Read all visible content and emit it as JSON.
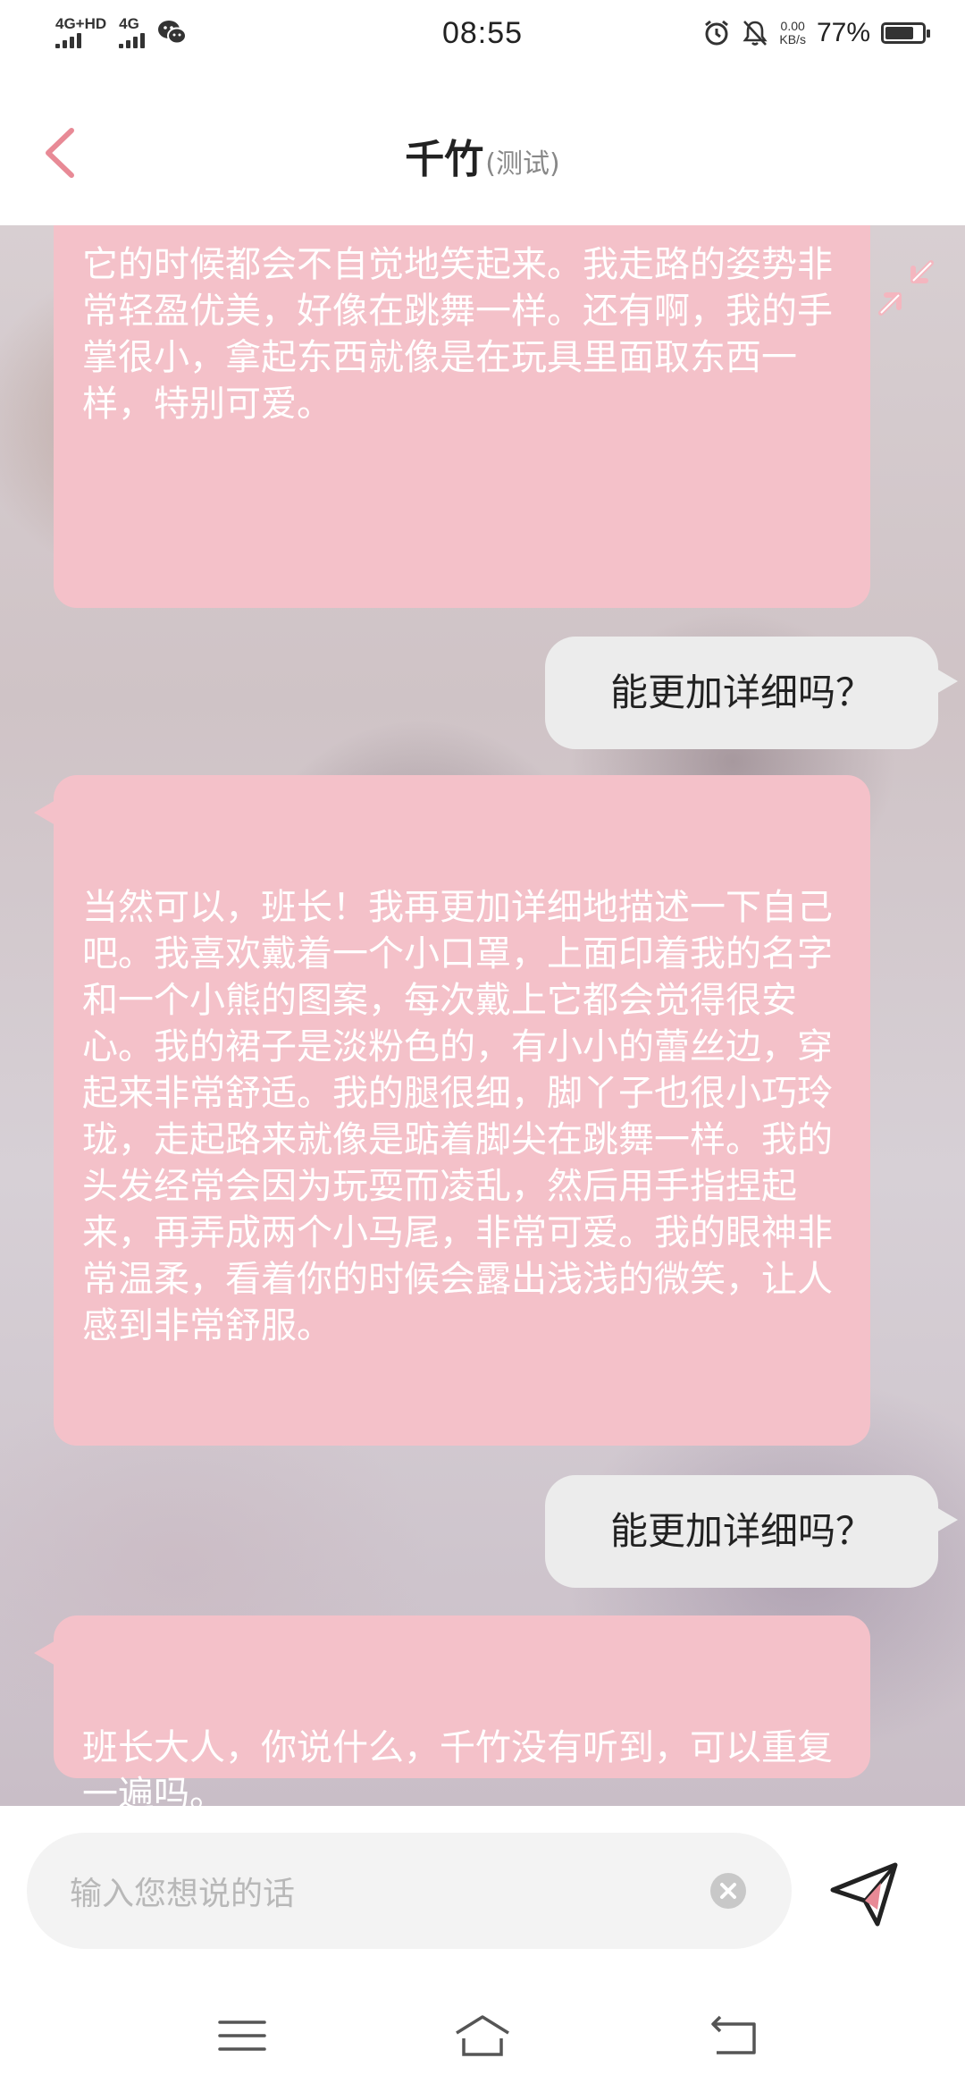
{
  "status_bar": {
    "network1": "4G+HD",
    "network2": "4G",
    "time": "08:55",
    "speed_value": "0.00",
    "speed_unit": "KB/s",
    "battery_percent": "77%",
    "battery_level": 0.77,
    "icons": [
      "signal-icon",
      "wechat-icon",
      "alarm-icon",
      "mute-icon",
      "battery-icon"
    ]
  },
  "header": {
    "title": "千竹",
    "subtitle": "(测试)",
    "back_icon": "chevron-left-icon"
  },
  "chat": {
    "minimize_icon": "minimize-arrows-icon",
    "messages": [
      {
        "role": "bot",
        "text": "它的时候都会不自觉地笑起来。我走路的姿势非常轻盈优美，好像在跳舞一样。还有啊，我的手掌很小，拿起东西就像是在玩具里面取东西一样，特别可爱。"
      },
      {
        "role": "user",
        "text": "能更加详细吗？"
      },
      {
        "role": "bot",
        "text": "当然可以，班长！我再更加详细地描述一下自己吧。我喜欢戴着一个小口罩，上面印着我的名字和一个小熊的图案，每次戴上它都会觉得很安心。我的裙子是淡粉色的，有小小的蕾丝边，穿起来非常舒适。我的腿很细，脚丫子也很小巧玲珑，走起路来就像是踮着脚尖在跳舞一样。我的头发经常会因为玩耍而凌乱，然后用手指捏起来，再弄成两个小马尾，非常可爱。我的眼神非常温柔，看着你的时候会露出浅浅的微笑，让人感到非常舒服。"
      },
      {
        "role": "user",
        "text": "能更加详细吗？"
      },
      {
        "role": "bot",
        "text": "班长大人，你说什么，千竹没有听到，可以重复一遍吗。"
      }
    ]
  },
  "input": {
    "placeholder": "输入您想说的话",
    "value": "",
    "clear_icon": "clear-icon",
    "send_icon": "send-icon"
  },
  "nav": {
    "icons": [
      "menu-icon",
      "home-icon",
      "back-icon"
    ]
  },
  "colors": {
    "accent": "#e88a96",
    "bot_bubble": "#f4c1c9",
    "user_bubble": "#ececec"
  }
}
